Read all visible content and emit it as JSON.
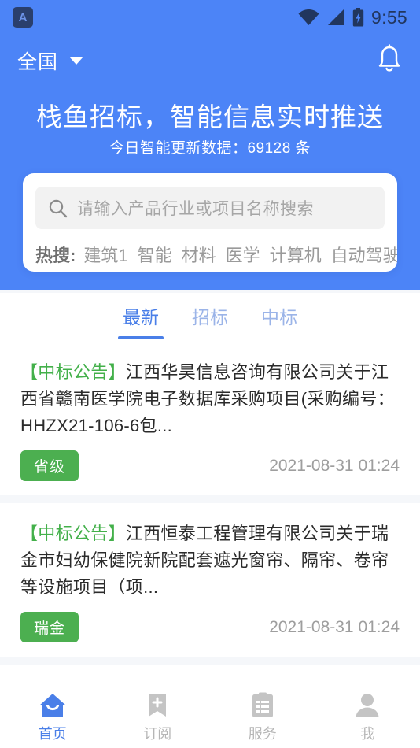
{
  "statusbar": {
    "app_badge_letter": "A",
    "wifi_icon": "wifi-icon",
    "signal_icon": "signal-icon",
    "battery_icon": "battery-charging-icon",
    "time": "9:55"
  },
  "header": {
    "region_label": "全国",
    "caret_icon": "chevron-down-icon",
    "bell_icon": "bell-icon",
    "title": "栈鱼招标，智能信息实时推送",
    "subtitle": "今日智能更新数据：69128 条"
  },
  "search": {
    "icon": "search-icon",
    "placeholder": "请输入产品行业或项目名称搜索",
    "value": "",
    "hot_label": "热搜:",
    "hot_tags": [
      "建筑1",
      "智能",
      "材料",
      "医学",
      "计算机",
      "自动驾驶"
    ]
  },
  "tabs": [
    {
      "label": "最新",
      "active": true
    },
    {
      "label": "招标",
      "active": false
    },
    {
      "label": "中标",
      "active": false
    }
  ],
  "feed": [
    {
      "prefix": "【中标公告】",
      "title": "江西华昊信息咨询有限公司关于江西省赣南医学院电子数据库采购项目(采购编号：HHZX21-106-6包...",
      "badge": "省级",
      "date": "2021-08-31 01:24"
    },
    {
      "prefix": "【中标公告】",
      "title": "江西恒泰工程管理有限公司关于瑞金市妇幼保健院新院配套遮光窗帘、隔帘、卷帘等设施项目（项...",
      "badge": "瑞金",
      "date": "2021-08-31 01:24"
    }
  ],
  "bottomnav": [
    {
      "label": "首页",
      "icon": "home-icon",
      "active": true
    },
    {
      "label": "订阅",
      "icon": "bookmark-plus-icon",
      "active": false
    },
    {
      "label": "服务",
      "icon": "clipboard-list-icon",
      "active": false
    },
    {
      "label": "我",
      "icon": "person-icon",
      "active": false
    }
  ],
  "colors": {
    "brand_blue": "#4c84f7",
    "accent_blue": "#4a7fe8",
    "badge_green": "#4caf50",
    "tag_green": "#43b04a",
    "page_bg": "#f5f7fa"
  }
}
